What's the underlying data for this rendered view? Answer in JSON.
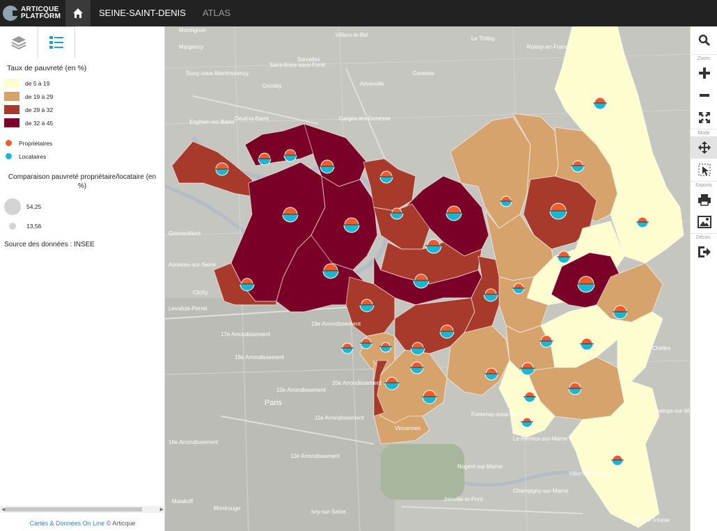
{
  "brand": {
    "line1": "ARTICQUE",
    "line2": "PLATFORM"
  },
  "nav": {
    "item1": "SEINE-SAINT-DENIS",
    "item2": "ATLAS"
  },
  "legend": {
    "title": "Taux de pauvreté (en %)",
    "classes": [
      {
        "label": "de 5 à 19",
        "color": "#fefdd0"
      },
      {
        "label": "de 19 à 29",
        "color": "#d6a36c"
      },
      {
        "label": "de 29 à 32",
        "color": "#a83a2b"
      },
      {
        "label": "de 32 à 45",
        "color": "#7a0028"
      }
    ],
    "symbols": [
      {
        "label": "Propriétaires",
        "color": "#f25a2a"
      },
      {
        "label": "Locataires",
        "color": "#1ab7d3"
      }
    ],
    "comparison_title": "Comparaison pauvreté propriétaire/locataire (en %)",
    "sizes": [
      {
        "label": "54,25"
      },
      {
        "label": "13,56"
      }
    ],
    "source": "Source des données : INSEE"
  },
  "footer": {
    "link": "Cartes & Données On Line",
    "suffix": "© Articque"
  },
  "toolbar": {
    "zoom_label": "Zoom",
    "mode_label": "Mode",
    "exports_label": "Exports",
    "decon_label": "Décon.",
    "icons": [
      "search-icon",
      "zoom-in-icon",
      "zoom-out-icon",
      "fullscreen-icon",
      "pan-icon",
      "select-icon",
      "print-icon",
      "image-icon",
      "logout-icon"
    ]
  },
  "map_labels": {
    "paris": "Paris",
    "arr19": "19e Arrondissement",
    "arr17": "17e Arrondissement",
    "arr18": "18e Arrondissement",
    "arr20": "20e Arrondissement",
    "arr11": "11e Arrondissement",
    "arr10": "10e Arrondissement",
    "arr12": "12e Arrondissement",
    "arr16": "16e Arrondissement",
    "gennevilliers": "Gennevilliers",
    "asnieres": "Asnières-sur-Seine",
    "clichy": "Clichy",
    "levallois": "Levallois-Perret",
    "enghien": "Enghien-les-Bains",
    "deuil": "Deuil-la-Barre",
    "sarcelles": "Sarcelles",
    "gonesse": "Gonesse",
    "arnouville": "Arnouville",
    "garges": "Garges-lès-Gonesse",
    "roissy": "Roissy-en-France",
    "villiers": "Villiers-le-Bel",
    "groslay": "Groslay",
    "montmorency": "Soisy-sous-Montmorency",
    "chelles": "Chelles",
    "champs": "Champs-sur-Marne",
    "villiers_marne": "Villiers-sur-Marne",
    "champigny": "Champigny-sur-Marne",
    "perreux": "Le Perreux-sur-Marne",
    "nogent": "Nogent-sur-Marne",
    "vincennes": "Vincennes",
    "fontenay": "Fontenay-sous-Bois",
    "malakoff": "Malakoff",
    "montrouge": "Montrouge",
    "ivry": "Ivry-sur-Seine",
    "joinville": "Joinville-le-Pont",
    "plessis": "Le Plessis-Trévise",
    "mortigny": "Montlignon",
    "margency": "Margency",
    "saint_brice": "Saint-Brice-sous-Forêt",
    "le_thillay": "Le Thillay"
  },
  "chart_data": {
    "type": "choropleth",
    "title": "Taux de pauvreté (en %)",
    "classes": [
      "de 5 à 19",
      "de 19 à 29",
      "de 29 à 32",
      "de 32 à 45"
    ]
  }
}
